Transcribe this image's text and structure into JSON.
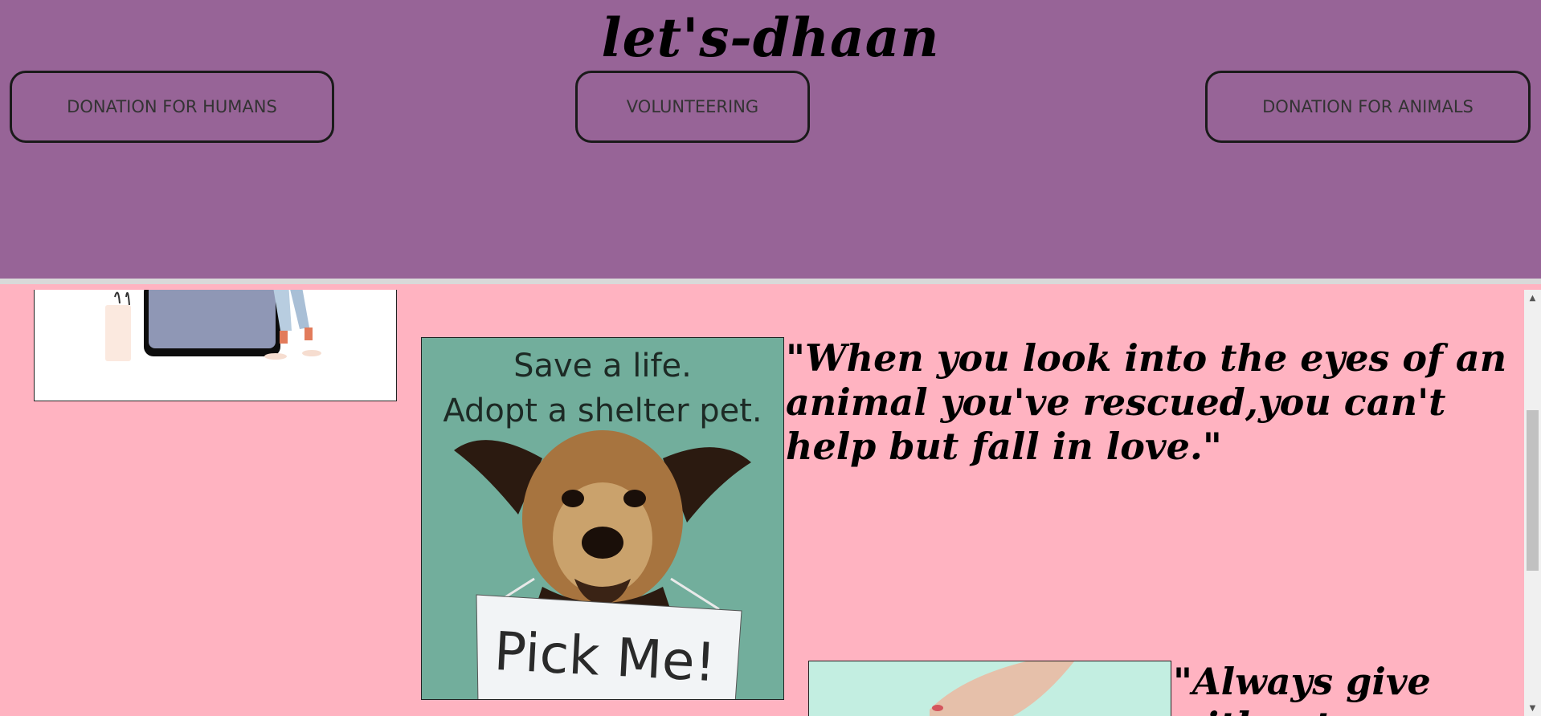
{
  "header": {
    "title": "let's-dhaan",
    "nav": {
      "humans_label": "DONATION FOR HUMANS",
      "volunteer_label": "VOLUNTEERING",
      "animals_label": "DONATION FOR ANIMALS"
    }
  },
  "main": {
    "quote_1": "\"When you look into the eyes of an animal you've rescued,you can't help but fall in love.\"",
    "quote_2": "\"Always give without",
    "poster": {
      "line_1": "Save a life.",
      "line_2": "Adopt a shelter pet.",
      "sign": "Pick Me!"
    }
  },
  "icons": {
    "scroll_up": "scroll-up-icon",
    "scroll_down": "scroll-down-icon"
  },
  "colors": {
    "header_bg": "#976497",
    "page_bg": "#ffb3c1",
    "poster_bg": "#72ae9c"
  }
}
